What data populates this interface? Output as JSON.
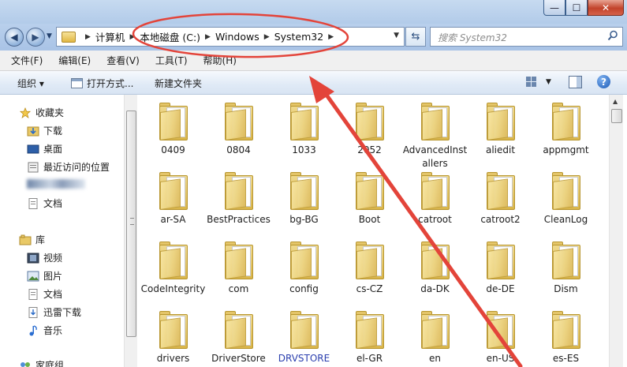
{
  "window": {
    "minimize_glyph": "—",
    "maximize_glyph": "☐",
    "close_glyph": "✕"
  },
  "address": {
    "breadcrumbs": [
      "计算机",
      "本地磁盘 (C:)",
      "Windows",
      "System32"
    ],
    "refresh_glyph": "⇆"
  },
  "search": {
    "placeholder": "搜索 System32"
  },
  "menu": {
    "items": [
      "文件(F)",
      "编辑(E)",
      "查看(V)",
      "工具(T)",
      "帮助(H)"
    ]
  },
  "commands": {
    "organize": "组织 ▾",
    "open_with": "打开方式...",
    "new_folder": "新建文件夹",
    "help_glyph": "?"
  },
  "nav": {
    "favorites": "收藏夹",
    "downloads": "下载",
    "desktop": "桌面",
    "recent": "最近访问的位置",
    "documents": "文档",
    "libraries": "库",
    "videos": "视频",
    "pictures": "图片",
    "lib_documents": "文档",
    "xunlei": "迅雷下载",
    "music": "音乐",
    "homegroup": "家庭组"
  },
  "folders": [
    "0409",
    "0804",
    "1033",
    "2052",
    "AdvancedInstallers",
    "aliedit",
    "appmgmt",
    "ar-SA",
    "BestPractices",
    "bg-BG",
    "Boot",
    "catroot",
    "catroot2",
    "CleanLog",
    "CodeIntegrity",
    "com",
    "config",
    "cs-CZ",
    "da-DK",
    "de-DE",
    "Dism",
    "drivers",
    "DriverStore",
    "DRVSTORE",
    "el-GR",
    "en",
    "en-US",
    "es-ES"
  ],
  "colors": {
    "annotation": "#e3443a",
    "highlight_folder_text": "#2b3fae"
  }
}
